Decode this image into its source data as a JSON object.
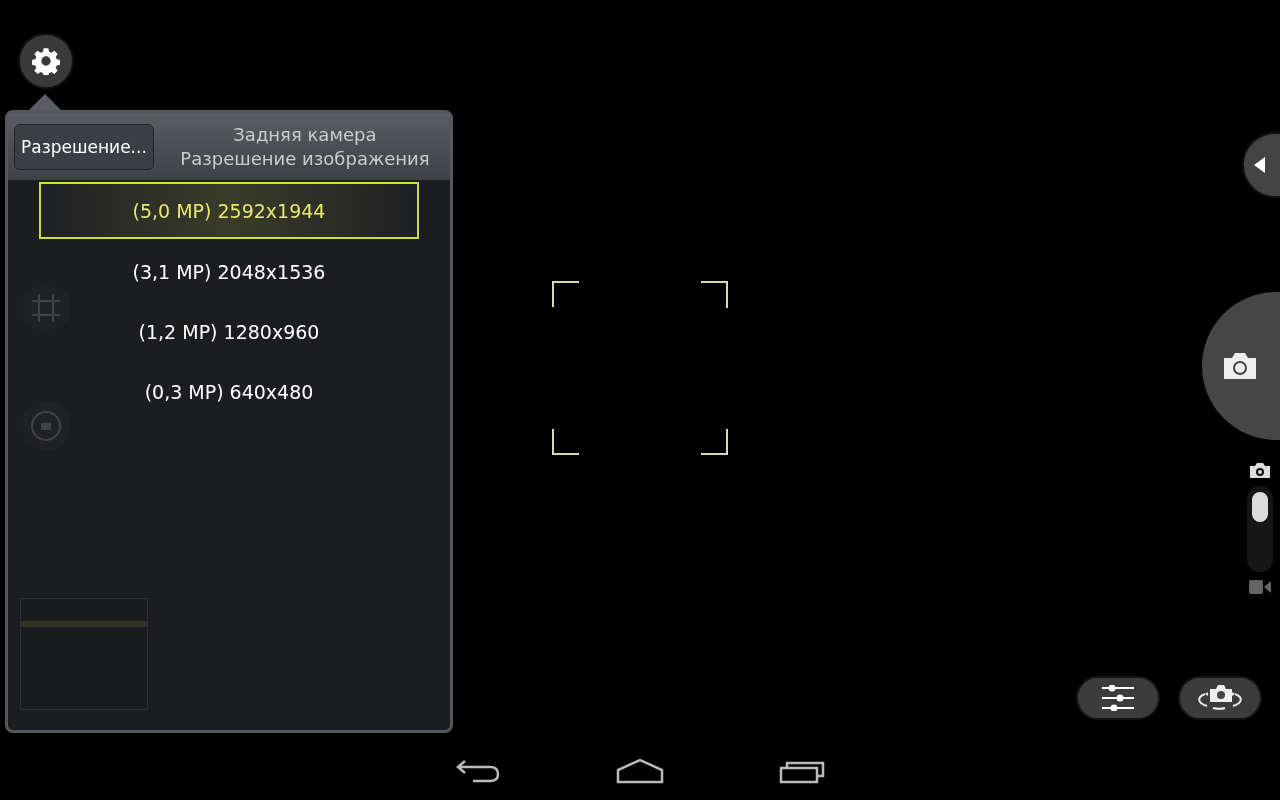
{
  "resolution_popup": {
    "button": "Разрешение...",
    "title": "Задняя камера",
    "subtitle": "Разрешение изображения",
    "options": [
      {
        "label": "(5,0 MP) 2592x1944",
        "selected": true
      },
      {
        "label": "(3,1 MP) 2048x1536",
        "selected": false
      },
      {
        "label": "(1,2 MP) 1280x960",
        "selected": false
      },
      {
        "label": "(0,3 MP) 640x480",
        "selected": false
      }
    ]
  },
  "camera_mode": [
    {
      "kind": "photo",
      "selected": true
    },
    {
      "kind": "video",
      "selected": false
    }
  ]
}
